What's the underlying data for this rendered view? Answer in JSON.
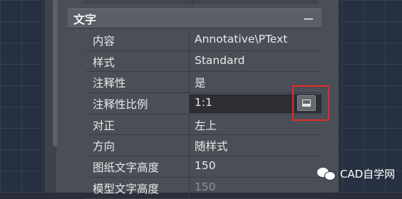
{
  "section": {
    "title": "文字",
    "collapse_symbol": "−"
  },
  "properties": [
    {
      "label": "内容",
      "value": "Annotative\\PText"
    },
    {
      "label": "样式",
      "value": "Standard"
    },
    {
      "label": "注释性",
      "value": "是"
    },
    {
      "label": "注释性比例",
      "value": "1:1",
      "editing": true
    },
    {
      "label": "对正",
      "value": "左上"
    },
    {
      "label": "方向",
      "value": "随样式"
    },
    {
      "label": "图纸文字高度",
      "value": "150"
    },
    {
      "label": "模型文字高度",
      "value": "150"
    }
  ],
  "picker_icon": "ellipsis-dialog-icon",
  "watermark": {
    "text": "CAD自学网",
    "icon": "wechat-icon"
  },
  "colors": {
    "panel": "#4a4e56",
    "header": "#5b5f67",
    "highlight": "#e32b2b",
    "background_grid": "#263040"
  }
}
